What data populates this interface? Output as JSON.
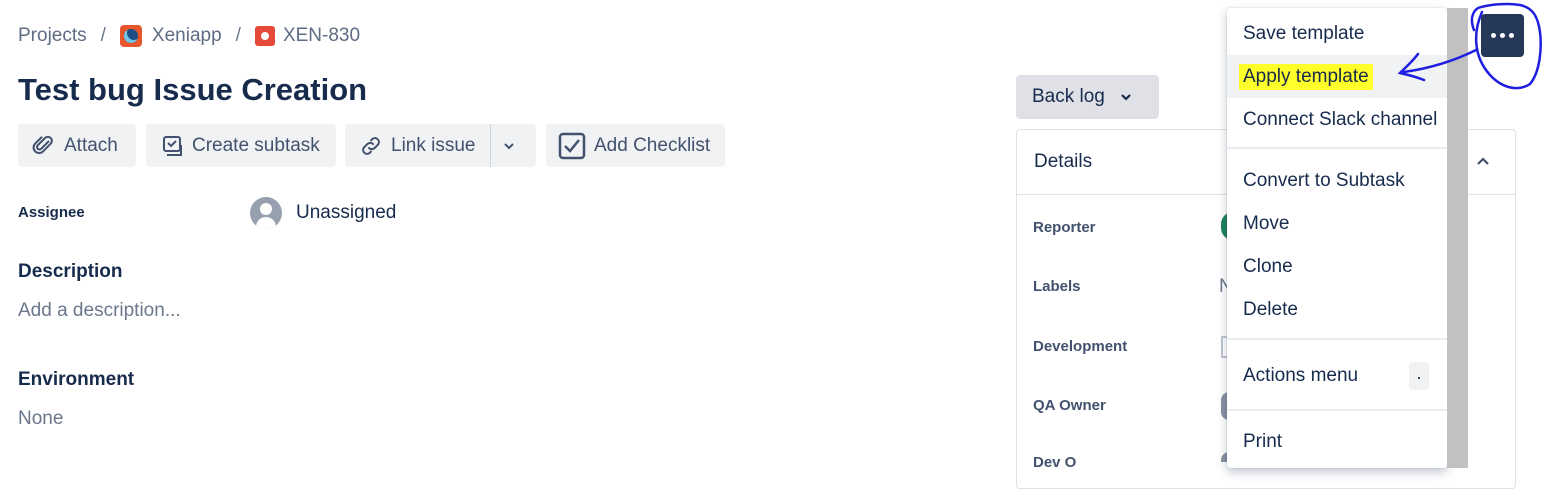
{
  "breadcrumb": {
    "projects": "Projects",
    "project": "Xeniapp",
    "issue_key": "XEN-830"
  },
  "issue": {
    "title": "Test bug Issue Creation"
  },
  "toolbar": {
    "attach": "Attach",
    "create_subtask": "Create subtask",
    "link_issue": "Link issue",
    "add_checklist": "Add Checklist"
  },
  "fields": {
    "assignee_label": "Assignee",
    "assignee_value": "Unassigned",
    "description_label": "Description",
    "description_placeholder": "Add a description...",
    "environment_label": "Environment",
    "environment_value": "None"
  },
  "status": {
    "label": "Back log"
  },
  "details": {
    "title": "Details",
    "reporter": "Reporter",
    "labels": "Labels",
    "labels_value": "N",
    "development": "Development",
    "qa_owner": "QA Owner",
    "dev_owner_partial": "Dev O"
  },
  "menu": {
    "items": [
      "Save template",
      "Apply template",
      "Connect Slack channel",
      "Convert to Subtask",
      "Move",
      "Clone",
      "Delete",
      "Actions menu",
      "Print"
    ],
    "shortcut": "."
  },
  "colors": {
    "accent": "#253858",
    "highlight": "#ffff29",
    "annotation": "#1f1fe0"
  }
}
